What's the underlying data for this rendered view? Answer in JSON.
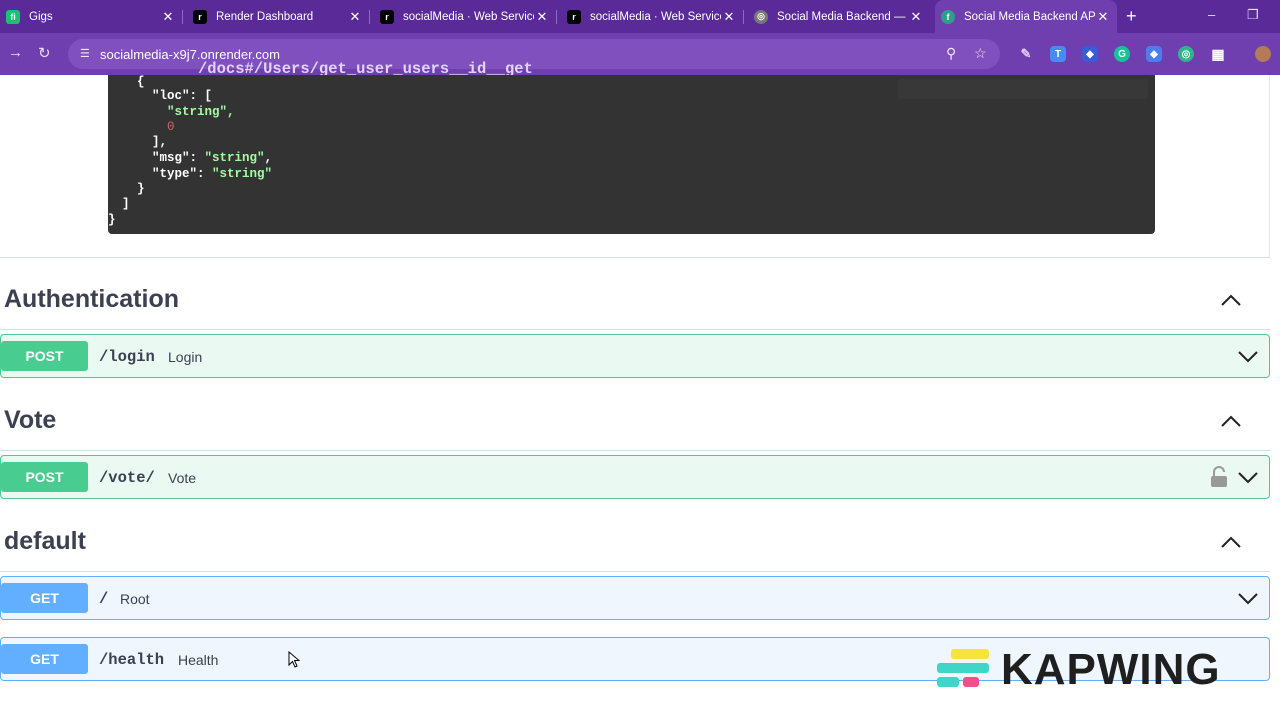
{
  "browser": {
    "tabs": [
      {
        "title": "Gigs",
        "favicon_color": "#1dbf73",
        "favicon_glyph": "fi"
      },
      {
        "title": "Render Dashboard",
        "favicon_color": "#000000",
        "favicon_glyph": "r"
      },
      {
        "title": "socialMedia · Web Service",
        "favicon_color": "#000000",
        "favicon_glyph": "r"
      },
      {
        "title": "socialMedia · Web Service",
        "favicon_color": "#000000",
        "favicon_glyph": "r"
      },
      {
        "title": "Social Media Backend — A",
        "favicon_color": "#777777",
        "favicon_glyph": "◎"
      },
      {
        "title": "Social Media Backend API",
        "favicon_color": "#2e9e88",
        "favicon_glyph": "f"
      }
    ],
    "new_tab_glyph": "+",
    "close_glyph": "✕",
    "url_host": "socialmedia-x9j7.onrender.com",
    "url_path": "/docs#/Users/get_user_users__id__get"
  },
  "code_sample": {
    "lines": [
      "  {",
      "    \"loc\": [",
      "      \"string\",",
      "      0",
      "    ],",
      "    \"msg\": \"string\",",
      "    \"type\": \"string\"",
      "  }",
      "]",
      "}"
    ]
  },
  "sections": [
    {
      "title": "Authentication",
      "ops": [
        {
          "method": "POST",
          "path": "/login",
          "summary": "Login",
          "locked": false
        }
      ]
    },
    {
      "title": "Vote",
      "ops": [
        {
          "method": "POST",
          "path": "/vote/",
          "summary": "Vote",
          "locked": true
        }
      ]
    },
    {
      "title": "default",
      "ops": [
        {
          "method": "GET",
          "path": "/",
          "summary": "Root",
          "locked": false
        },
        {
          "method": "GET",
          "path": "/health",
          "summary": "Health",
          "locked": false
        }
      ]
    }
  ],
  "watermark": "KAPWING",
  "colors": {
    "post": "#49cc90",
    "get": "#61affe",
    "browser_accent": "#6f3fb0"
  }
}
